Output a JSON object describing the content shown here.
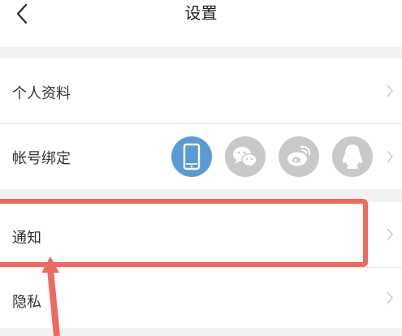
{
  "header": {
    "title": "设置",
    "back_icon": "chevron-left-icon"
  },
  "settings": {
    "items": [
      {
        "label": "个人资料"
      },
      {
        "label": "帐号绑定"
      },
      {
        "label": "通知"
      },
      {
        "label": "隐私"
      }
    ],
    "account_binding_icons": [
      {
        "name": "phone-icon",
        "active": true,
        "color": "#5b9bd5"
      },
      {
        "name": "wechat-icon",
        "active": false,
        "color": "#c8c8c8"
      },
      {
        "name": "weibo-icon",
        "active": false,
        "color": "#c8c8c8"
      },
      {
        "name": "qq-icon",
        "active": false,
        "color": "#c8c8c8"
      }
    ]
  },
  "annotation": {
    "color": "#ee6a5e"
  }
}
